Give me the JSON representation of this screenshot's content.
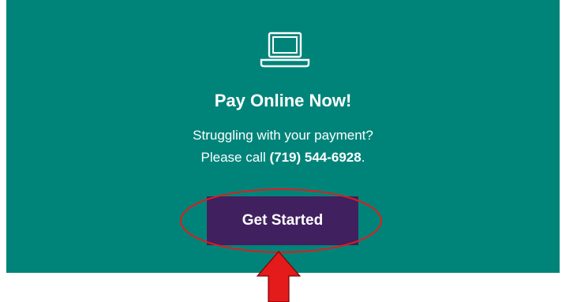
{
  "banner": {
    "icon": "laptop-icon",
    "title": "Pay Online Now!",
    "line1": "Struggling with your payment?",
    "line2_prefix": "Please call ",
    "phone": "(719) 544-6928",
    "line2_suffix": ".",
    "button_label": "Get Started"
  },
  "colors": {
    "panel": "#00847a",
    "button": "#41205f",
    "annotation": "#e31b1b"
  }
}
